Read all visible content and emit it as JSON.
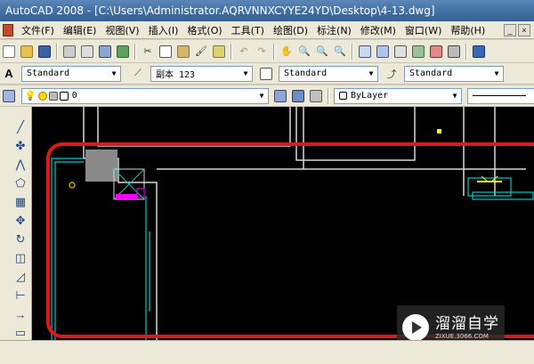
{
  "window": {
    "title": "AutoCAD 2008 - [C:\\Users\\Administrator.AQRVNNXCYYE24YD\\Desktop\\4-13.dwg]"
  },
  "menubar": {
    "items": [
      {
        "label": "文件(F)"
      },
      {
        "label": "编辑(E)"
      },
      {
        "label": "视图(V)"
      },
      {
        "label": "插入(I)"
      },
      {
        "label": "格式(O)"
      },
      {
        "label": "工具(T)"
      },
      {
        "label": "绘图(D)"
      },
      {
        "label": "标注(N)"
      },
      {
        "label": "修改(M)"
      },
      {
        "label": "窗口(W)"
      },
      {
        "label": "帮助(H)"
      }
    ]
  },
  "styles_toolbar": {
    "text_style": "Standard",
    "dim_style": "副本 123",
    "table_style": "Standard",
    "multileader_style": "Standard"
  },
  "layers_toolbar": {
    "current_layer": "0",
    "color_control": "ByLayer"
  },
  "watermark": {
    "name": "溜溜自学",
    "url": "ZIXUE.3066.COM"
  },
  "colors": {
    "canvas_bg": "#000000",
    "highlight_red": "#e01818",
    "wall_white": "#d8d8d8",
    "cyan_lines": "#00c8c8",
    "magenta": "#ff00ff",
    "yellow": "#ffff00"
  }
}
